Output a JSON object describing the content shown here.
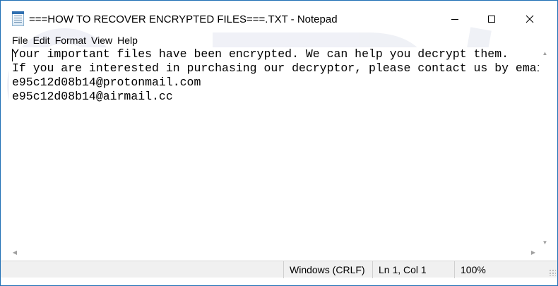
{
  "window": {
    "title": "===HOW TO RECOVER ENCRYPTED FILES===.TXT - Notepad"
  },
  "title_buttons": {
    "minimize_icon": "minimize-icon",
    "maximize_icon": "maximize-icon",
    "close_icon": "close-icon"
  },
  "menu": {
    "items": [
      "File",
      "Edit",
      "Format",
      "View",
      "Help"
    ]
  },
  "document": {
    "lines": [
      "Your important files have been encrypted. We can help you decrypt them.",
      "If you are interested in purchasing our decryptor, please contact us by email:",
      "e95c12d08b14@protonmail.com",
      "e95c12d08b14@airmail.cc"
    ]
  },
  "status": {
    "encoding": "Windows (CRLF)",
    "position": "Ln 1, Col 1",
    "zoom": "100%"
  },
  "colors": {
    "window_border": "#1f6fb5",
    "statusbar_bg": "#f0f0f0",
    "text": "#000000"
  }
}
